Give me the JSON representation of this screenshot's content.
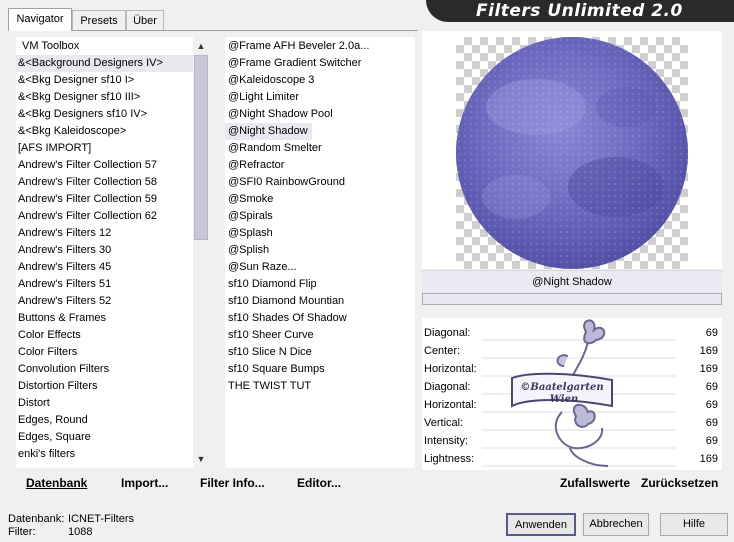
{
  "tabs": [
    "Navigator",
    "Presets",
    "Über"
  ],
  "banner_title": "Filters Unlimited 2.0",
  "categories": [
    "VM Toolbox",
    "&<Background Designers IV>",
    "&<Bkg Designer sf10 I>",
    "&<Bkg Designer sf10 III>",
    "&<Bkg Designers sf10 IV>",
    "&<Bkg Kaleidoscope>",
    "[AFS IMPORT]",
    "Andrew's Filter Collection 57",
    "Andrew's Filter Collection 58",
    "Andrew's Filter Collection 59",
    "Andrew's Filter Collection 62",
    "Andrew's Filters 12",
    "Andrew's Filters 30",
    "Andrew's Filters 45",
    "Andrew's Filters 51",
    "Andrew's Filters 52",
    "Buttons & Frames",
    "Color Effects",
    "Color Filters",
    "Convolution Filters",
    "Distortion Filters",
    "Distort",
    "Edges, Round",
    "Edges, Square",
    "enki's filters"
  ],
  "selected_category": "&<Background Designers IV>",
  "filters": [
    "@Frame AFH Beveler 2.0a...",
    "@Frame Gradient Switcher",
    "@Kaleidoscope 3",
    "@Light Limiter",
    "@Night Shadow Pool",
    "@Night Shadow",
    "@Random Smelter",
    "@Refractor",
    "@SFI0 RainbowGround",
    "@Smoke",
    "@Spirals",
    "@Splash",
    "@Splish",
    "@Sun Raze...",
    "sf10 Diamond Flip",
    "sf10 Diamond Mountian",
    "sf10 Shades Of Shadow",
    "sf10 Sheer Curve",
    "sf10 Slice N Dice",
    "sf10 Square Bumps",
    "THE TWIST TUT"
  ],
  "selected_filter": "@Night Shadow",
  "preview_filter_name": "@Night Shadow",
  "params": [
    {
      "label": "Diagonal:",
      "value": "69"
    },
    {
      "label": "Center:",
      "value": "169"
    },
    {
      "label": "Horizontal:",
      "value": "169"
    },
    {
      "label": "Diagonal:",
      "value": "69"
    },
    {
      "label": "Horizontal:",
      "value": "69"
    },
    {
      "label": "Vertical:",
      "value": "69"
    },
    {
      "label": "Intensity:",
      "value": "69"
    },
    {
      "label": "Lightness:",
      "value": "169"
    }
  ],
  "watermark_text": [
    "©Baatelgarten",
    "Wien"
  ],
  "bottom_bar": {
    "datenbank": "Datenbank",
    "import": "Import...",
    "filter_info": "Filter Info...",
    "editor": "Editor...",
    "zufallswerte": "Zufallswerte",
    "zuruecksetzen": "Zurücksetzen"
  },
  "status": {
    "datenbank_label": "Datenbank:",
    "datenbank_value": "ICNET-Filters",
    "filter_label": "Filter:",
    "filter_value": "1088"
  },
  "buttons": {
    "apply": "Anwenden",
    "cancel": "Abbrechen",
    "help": "Hilfe"
  },
  "scroll_arrows": {
    "up": "▲",
    "down": "▼"
  },
  "colors": {
    "sphere": "#7c78c8",
    "banner": "#2a2a2a"
  }
}
